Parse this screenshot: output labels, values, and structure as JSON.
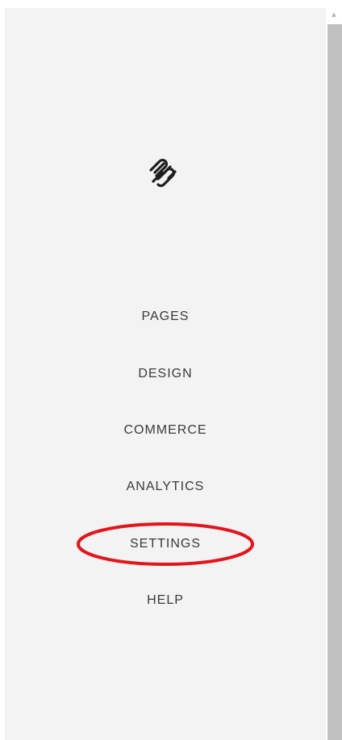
{
  "logo": {
    "icon": "squarespace-logo-icon"
  },
  "nav": {
    "items": [
      {
        "label": "PAGES"
      },
      {
        "label": "DESIGN"
      },
      {
        "label": "COMMERCE"
      },
      {
        "label": "ANALYTICS"
      },
      {
        "label": "SETTINGS"
      },
      {
        "label": "HELP"
      }
    ]
  },
  "annotation": {
    "highlight_color": "#e3151b",
    "highlighted_item": "SETTINGS"
  },
  "colors": {
    "sidebar_background": "#f3f3f3",
    "nav_text": "#3a3a3a",
    "scrollbar_thumb": "#c1c1c1"
  }
}
